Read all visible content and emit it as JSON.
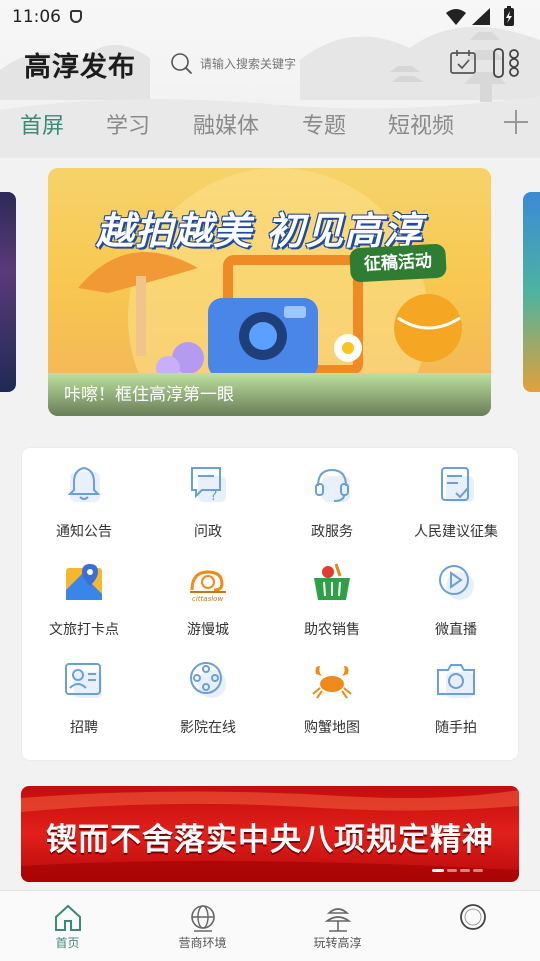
{
  "status_bar": {
    "time": "11:06"
  },
  "header": {
    "app_title": "高淳发布",
    "search_placeholder": "请输入搜索关键字"
  },
  "tabs": [
    {
      "label": "首屏",
      "active": true
    },
    {
      "label": "学习",
      "active": false
    },
    {
      "label": "融媒体",
      "active": false
    },
    {
      "label": "专题",
      "active": false
    },
    {
      "label": "短视频",
      "active": false
    }
  ],
  "banner": {
    "headline": "越拍越美 初见高淳",
    "tag": "征稿活动",
    "caption": "咔嚓！框住高淳第一眼"
  },
  "services": [
    {
      "label": "通知公告",
      "icon": "bell-icon"
    },
    {
      "label": "问政",
      "icon": "question-chat-icon"
    },
    {
      "label": "政服务",
      "icon": "headset-icon"
    },
    {
      "label": "人民建议征集",
      "icon": "checklist-icon"
    },
    {
      "label": "文旅打卡点",
      "icon": "map-pin-icon"
    },
    {
      "label": "游慢城",
      "icon": "snail-icon",
      "logo_text": "cittaslow"
    },
    {
      "label": "助农销售",
      "icon": "produce-basket-icon"
    },
    {
      "label": "微直播",
      "icon": "live-play-icon"
    },
    {
      "label": "招聘",
      "icon": "id-card-icon"
    },
    {
      "label": "影院在线",
      "icon": "film-reel-icon"
    },
    {
      "label": "购蟹地图",
      "icon": "crab-icon"
    },
    {
      "label": "随手拍",
      "icon": "camera-icon"
    }
  ],
  "slogan_banner": {
    "text": "锲而不舍落实中央八项规定精神"
  },
  "bottom_nav": [
    {
      "label": "首页",
      "active": true,
      "icon": "home-icon"
    },
    {
      "label": "营商环境",
      "active": false,
      "icon": "globe-icon"
    },
    {
      "label": "玩转高淳",
      "active": false,
      "icon": "pagoda-icon"
    },
    {
      "label": "",
      "active": false,
      "icon": "profile-circle-icon"
    }
  ],
  "colors": {
    "accent": "#3b8a74",
    "icon_blue": "#6b9fd9",
    "slogan_red": "#d4161a"
  }
}
